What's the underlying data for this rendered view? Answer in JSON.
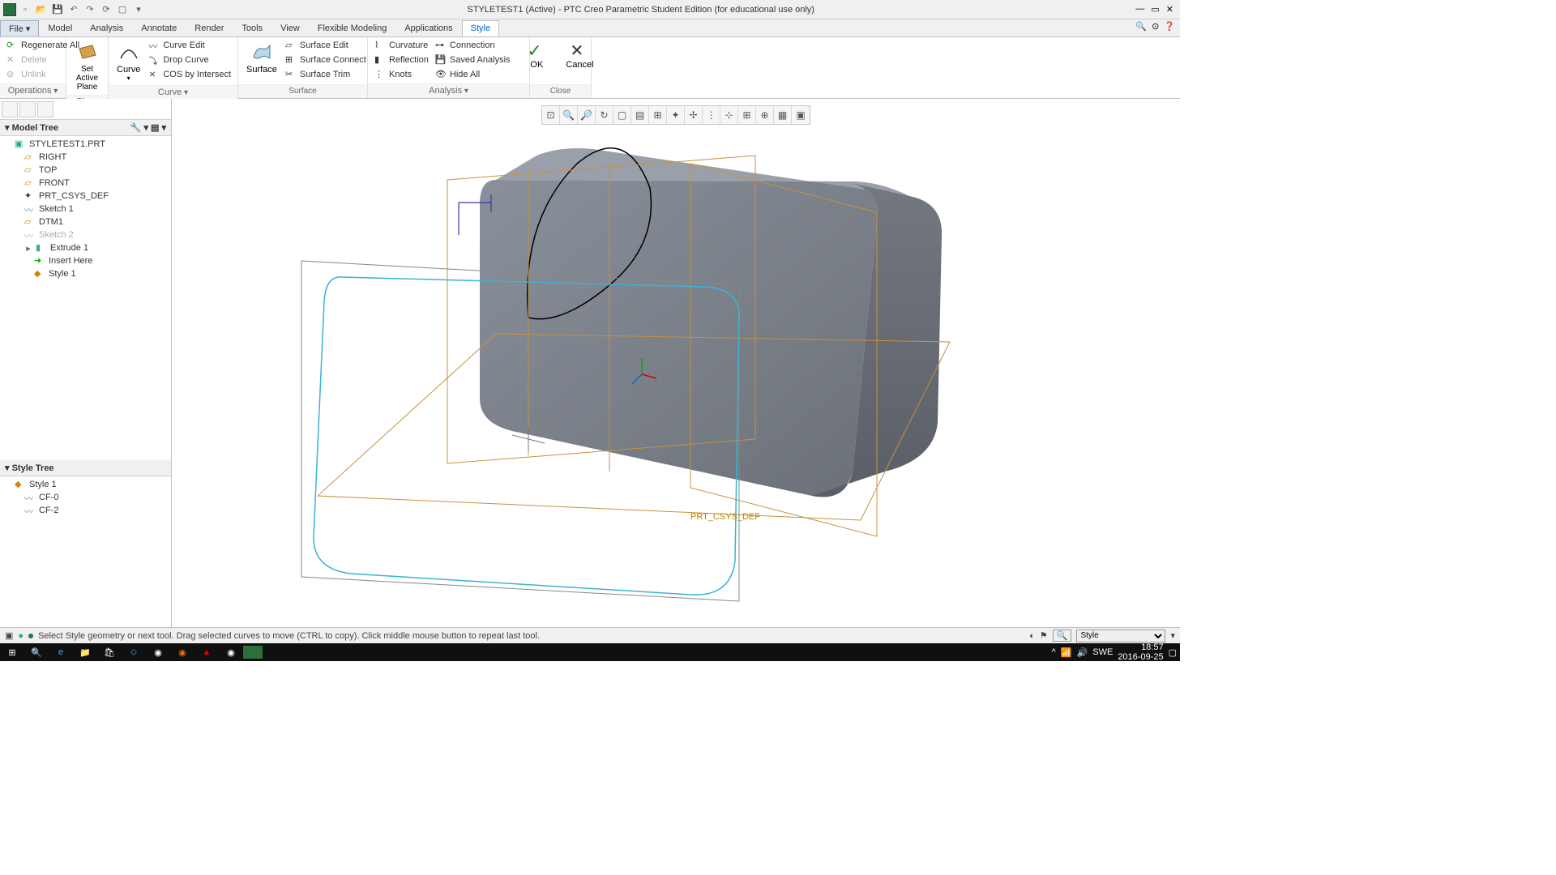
{
  "title": "STYLETEST1 (Active) - PTC Creo Parametric Student Edition (for educational use only)",
  "tabs": {
    "file": "File",
    "model": "Model",
    "analysis": "Analysis",
    "annotate": "Annotate",
    "render": "Render",
    "tools": "Tools",
    "view": "View",
    "flexible": "Flexible Modeling",
    "applications": "Applications",
    "style": "Style"
  },
  "ribbon": {
    "operations": {
      "regenerate": "Regenerate All",
      "delete": "Delete",
      "unlink": "Unlink",
      "label": "Operations"
    },
    "plane": {
      "setactive": "Set Active Plane",
      "label": "Plane"
    },
    "curve": {
      "curve": "Curve",
      "curveedit": "Curve Edit",
      "dropcurve": "Drop Curve",
      "cosbyintersect": "COS by Intersect",
      "label": "Curve"
    },
    "surface": {
      "surface": "Surface",
      "surfaceedit": "Surface Edit",
      "surfaceconnect": "Surface Connect",
      "surfacetrim": "Surface Trim",
      "label": "Surface"
    },
    "analysis_g": {
      "curvature": "Curvature",
      "reflection": "Reflection",
      "knots": "Knots",
      "connection": "Connection",
      "savedanalysis": "Saved Analysis",
      "hideall": "Hide All",
      "label": "Analysis"
    },
    "close": {
      "ok": "OK",
      "cancel": "Cancel",
      "label": "Close"
    }
  },
  "modeltree": {
    "header": "Model Tree",
    "root": "STYLETEST1.PRT",
    "items": [
      "RIGHT",
      "TOP",
      "FRONT",
      "PRT_CSYS_DEF",
      "Sketch 1",
      "DTM1",
      "Sketch 2",
      "Extrude 1",
      "Insert Here",
      "Style 1"
    ]
  },
  "styletree": {
    "header": "Style Tree",
    "root": "Style 1",
    "items": [
      "CF-0",
      "CF-2"
    ]
  },
  "status": "Select Style geometry or next tool. Drag selected curves to move (CTRL to copy). Click middle mouse button to repeat last tool.",
  "status_mode": "Style",
  "csys_label": "PRT_CSYS_DEF",
  "taskbar": {
    "time": "18:57",
    "date": "2016-09-25",
    "lang": "SWE"
  }
}
